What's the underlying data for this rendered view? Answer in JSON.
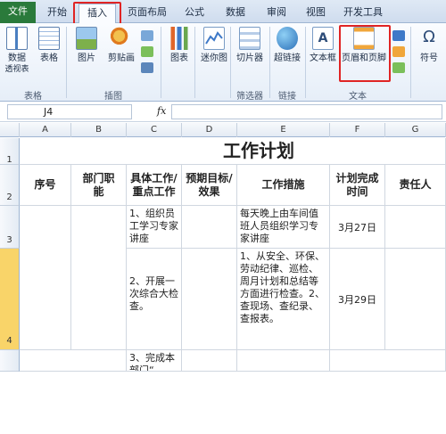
{
  "tabs": [
    {
      "label": "文件"
    },
    {
      "label": "开始"
    },
    {
      "label": "插入"
    },
    {
      "label": "页面布局"
    },
    {
      "label": "公式"
    },
    {
      "label": "数据"
    },
    {
      "label": "审阅"
    },
    {
      "label": "视图"
    },
    {
      "label": "开发工具"
    }
  ],
  "ribbon": {
    "pivot_label": "数据",
    "pivot_label2": "透视表",
    "table_label": "表格",
    "picture_label": "图片",
    "clipart_label": "剪贴画",
    "chart_label": "图表",
    "sparkline_label": "迷你图",
    "slicer_label": "切片器",
    "hyperlink_label": "超链接",
    "textbox_label": "文本框",
    "headerfooter_label": "页眉和页脚",
    "symbol_label": "符号",
    "groups": {
      "tables": "表格",
      "illustrations": "插图",
      "filter": "筛选器",
      "links": "链接",
      "text": "文本"
    }
  },
  "formula_bar": {
    "name_box": "J4",
    "fx": "fx",
    "value": ""
  },
  "columns": [
    "A",
    "B",
    "C",
    "D",
    "E",
    "F",
    "G"
  ],
  "rows": [
    "1",
    "2",
    "3",
    "4"
  ],
  "sheet": {
    "title": "工作计划",
    "headers": [
      "序号",
      "部门职能",
      "具体工作/重点工作",
      "预期目标/效果",
      "工作措施",
      "计划完成时间",
      "责任人"
    ],
    "row3": {
      "work": "1、组织员工学习专家讲座",
      "measure": "每天晚上由车间值班人员组织学习专家讲座",
      "date": "3月27日"
    },
    "row4": {
      "work": "2、开展一次综合大检查。",
      "measure": "1、从安全、环保、劳动纪律、巡检、周月计划和总结等方面进行检查。2、查现场、查纪录、查报表。",
      "date": "3月29日"
    },
    "row5": {
      "work": "3、完成本部门“"
    }
  }
}
